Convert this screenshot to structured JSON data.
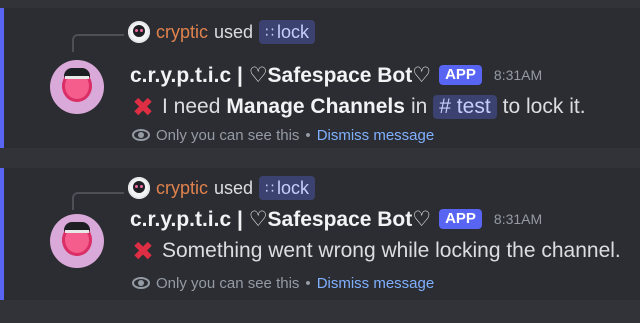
{
  "messages": [
    {
      "reply": {
        "user": "cryptic",
        "used": "used",
        "command": "lock"
      },
      "bot": {
        "name": "c.r.y.p.t.i.c | ♡Safespace Bot♡",
        "tag": "APP",
        "time": "8:31AM"
      },
      "body": {
        "icon": "✖",
        "text_before": "I need",
        "bold": "Manage Channels",
        "text_mid": "in",
        "channel": "# test",
        "text_after": "to lock it."
      },
      "footer": {
        "notice": "Only you can see this",
        "separator": "•",
        "dismiss": "Dismiss message"
      }
    },
    {
      "reply": {
        "user": "cryptic",
        "used": "used",
        "command": "lock"
      },
      "bot": {
        "name": "c.r.y.p.t.i.c | ♡Safespace Bot♡",
        "tag": "APP",
        "time": "8:31AM"
      },
      "body": {
        "icon": "✖",
        "text": "Something went wrong while locking the channel."
      },
      "footer": {
        "notice": "Only you can see this",
        "separator": "•",
        "dismiss": "Dismiss message"
      }
    }
  ],
  "colors": {
    "background": "#313338",
    "highlight": "#2c2d32",
    "accent_bar": "#5865f2",
    "username": "#e0824d",
    "error": "#dd2e44",
    "link": "#7fb0ff"
  },
  "icons": {
    "command": "slash-command-icon",
    "error": "x-mark-icon",
    "ephemeral": "eye-icon"
  }
}
